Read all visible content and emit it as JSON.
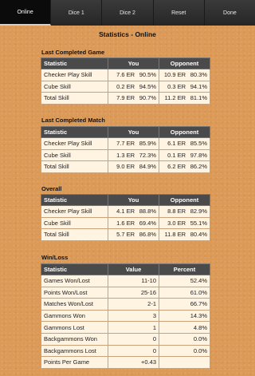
{
  "tabs": [
    "Online",
    "Dice 1",
    "Dice 2",
    "Reset",
    "Done"
  ],
  "title": "Statistics - Online",
  "sections": {
    "game": {
      "title": "Last Completed Game",
      "headers": [
        "Statistic",
        "You",
        "Opponent"
      ],
      "rows": [
        {
          "label": "Checker Play Skill",
          "you_er": "7.6 ER",
          "you_pct": "90.5%",
          "opp_er": "10.9 ER",
          "opp_pct": "80.3%"
        },
        {
          "label": "Cube Skill",
          "you_er": "0.2 ER",
          "you_pct": "94.5%",
          "opp_er": "0.3 ER",
          "opp_pct": "94.1%"
        },
        {
          "label": "Total Skill",
          "you_er": "7.9 ER",
          "you_pct": "90.7%",
          "opp_er": "11.2 ER",
          "opp_pct": "81.1%"
        }
      ]
    },
    "match": {
      "title": "Last Completed Match",
      "headers": [
        "Statistic",
        "You",
        "Opponent"
      ],
      "rows": [
        {
          "label": "Checker Play Skill",
          "you_er": "7.7 ER",
          "you_pct": "85.9%",
          "opp_er": "6.1 ER",
          "opp_pct": "85.5%"
        },
        {
          "label": "Cube Skill",
          "you_er": "1.3 ER",
          "you_pct": "72.3%",
          "opp_er": "0.1 ER",
          "opp_pct": "97.8%"
        },
        {
          "label": "Total Skill",
          "you_er": "9.0 ER",
          "you_pct": "84.9%",
          "opp_er": "6.2 ER",
          "opp_pct": "86.2%"
        }
      ]
    },
    "overall": {
      "title": "Overall",
      "headers": [
        "Statistic",
        "You",
        "Opponent"
      ],
      "rows": [
        {
          "label": "Checker Play Skill",
          "you_er": "4.1 ER",
          "you_pct": "88.8%",
          "opp_er": "8.8 ER",
          "opp_pct": "82.9%"
        },
        {
          "label": "Cube Skill",
          "you_er": "1.6 ER",
          "you_pct": "69.4%",
          "opp_er": "3.0 ER",
          "opp_pct": "55.1%"
        },
        {
          "label": "Total Skill",
          "you_er": "5.7 ER",
          "you_pct": "86.8%",
          "opp_er": "11.8 ER",
          "opp_pct": "80.4%"
        }
      ]
    },
    "winloss": {
      "title": "Win/Loss",
      "headers": [
        "Statistic",
        "Value",
        "Percent"
      ],
      "rows": [
        {
          "label": "Games Won/Lost",
          "value": "11-10",
          "percent": "52.4%"
        },
        {
          "label": "Points Won/Lost",
          "value": "25-16",
          "percent": "61.0%"
        },
        {
          "label": "Matches Won/Lost",
          "value": "2-1",
          "percent": "66.7%"
        },
        {
          "label": "Gammons Won",
          "value": "3",
          "percent": "14.3%"
        },
        {
          "label": "Gammons Lost",
          "value": "1",
          "percent": "4.8%"
        },
        {
          "label": "Backgammons Won",
          "value": "0",
          "percent": "0.0%"
        },
        {
          "label": "Backgammons Lost",
          "value": "0",
          "percent": "0.0%"
        },
        {
          "label": "Points Per Game",
          "value": "+0.43",
          "percent": ""
        }
      ]
    }
  }
}
